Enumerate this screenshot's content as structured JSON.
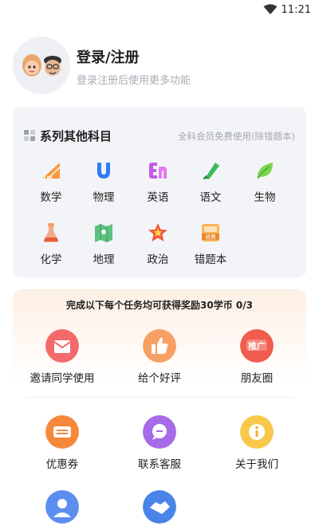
{
  "status_bar": {
    "time": "11:21"
  },
  "profile": {
    "title": "登录/注册",
    "subtitle": "登录注册后使用更多功能"
  },
  "subjects": {
    "title": "系列其他科目",
    "note": "全科会员免费使用(除错题本)",
    "items": [
      {
        "label": "数学",
        "icon": "math-ruler-icon"
      },
      {
        "label": "物理",
        "icon": "magnet-icon"
      },
      {
        "label": "英语",
        "icon": "english-en-icon"
      },
      {
        "label": "语文",
        "icon": "brush-pen-icon"
      },
      {
        "label": "生物",
        "icon": "leaf-icon"
      },
      {
        "label": "化学",
        "icon": "flask-icon"
      },
      {
        "label": "地理",
        "icon": "map-icon"
      },
      {
        "label": "政治",
        "icon": "star-badge-icon"
      },
      {
        "label": "错题本",
        "icon": "paid-notebook-icon",
        "badge": "收费"
      }
    ]
  },
  "tasks": {
    "banner": "完成以下每个任务均可获得奖励30学币 0/3",
    "task_items": [
      {
        "label": "邀请同学使用",
        "icon": "invite-icon"
      },
      {
        "label": "给个好评",
        "icon": "thumbs-up-icon"
      },
      {
        "label": "朋友圈",
        "icon": "promote-icon",
        "badge": "推广"
      }
    ],
    "other_items": [
      {
        "label": "优惠券",
        "icon": "coupon-icon"
      },
      {
        "label": "联系客服",
        "icon": "chat-icon"
      },
      {
        "label": "关于我们",
        "icon": "info-icon"
      },
      {
        "label": "",
        "icon": "user-icon"
      },
      {
        "label": "",
        "icon": "handshake-icon"
      }
    ]
  },
  "colors": {
    "card_bg": "#f3f4f8",
    "muted_text": "#a8acb5",
    "accent_orange": "#f5883b"
  }
}
